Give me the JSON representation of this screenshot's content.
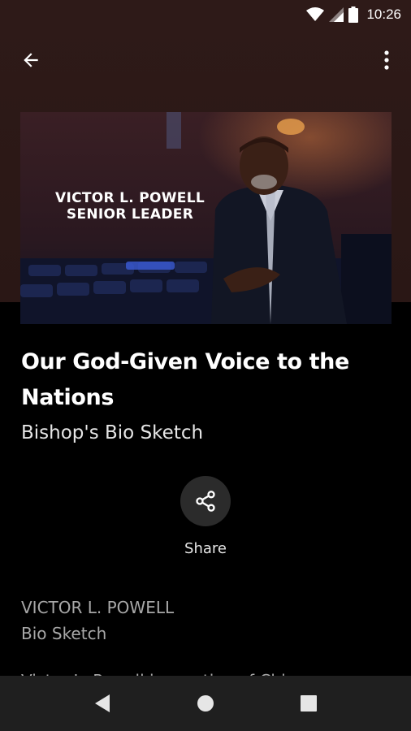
{
  "status_bar": {
    "time": "10:26",
    "icons": [
      "wifi-icon",
      "signal-icon",
      "battery-icon"
    ]
  },
  "app_bar": {
    "back_icon": "arrow-back-icon",
    "more_icon": "more-vert-icon"
  },
  "hero": {
    "caption_line1": "VICTOR L. POWELL",
    "caption_line2": "SENIOR LEADER"
  },
  "content": {
    "title": "Our God-Given Voice to the Nations",
    "subtitle": "Bishop's Bio Sketch",
    "share_label": "Share",
    "author": "VICTOR L. POWELL",
    "author_sub": "Bio Sketch",
    "body_peek": "Victor L. Powell is a native of Chicago"
  },
  "nav_bar": {
    "back": "back-triangle-icon",
    "home": "home-circle-icon",
    "recents": "recents-square-icon"
  },
  "colors": {
    "header_bg": "#2e1a18",
    "page_bg": "#000000",
    "navbar_bg": "#1f1f1f",
    "share_bg": "#2b2b2b"
  }
}
